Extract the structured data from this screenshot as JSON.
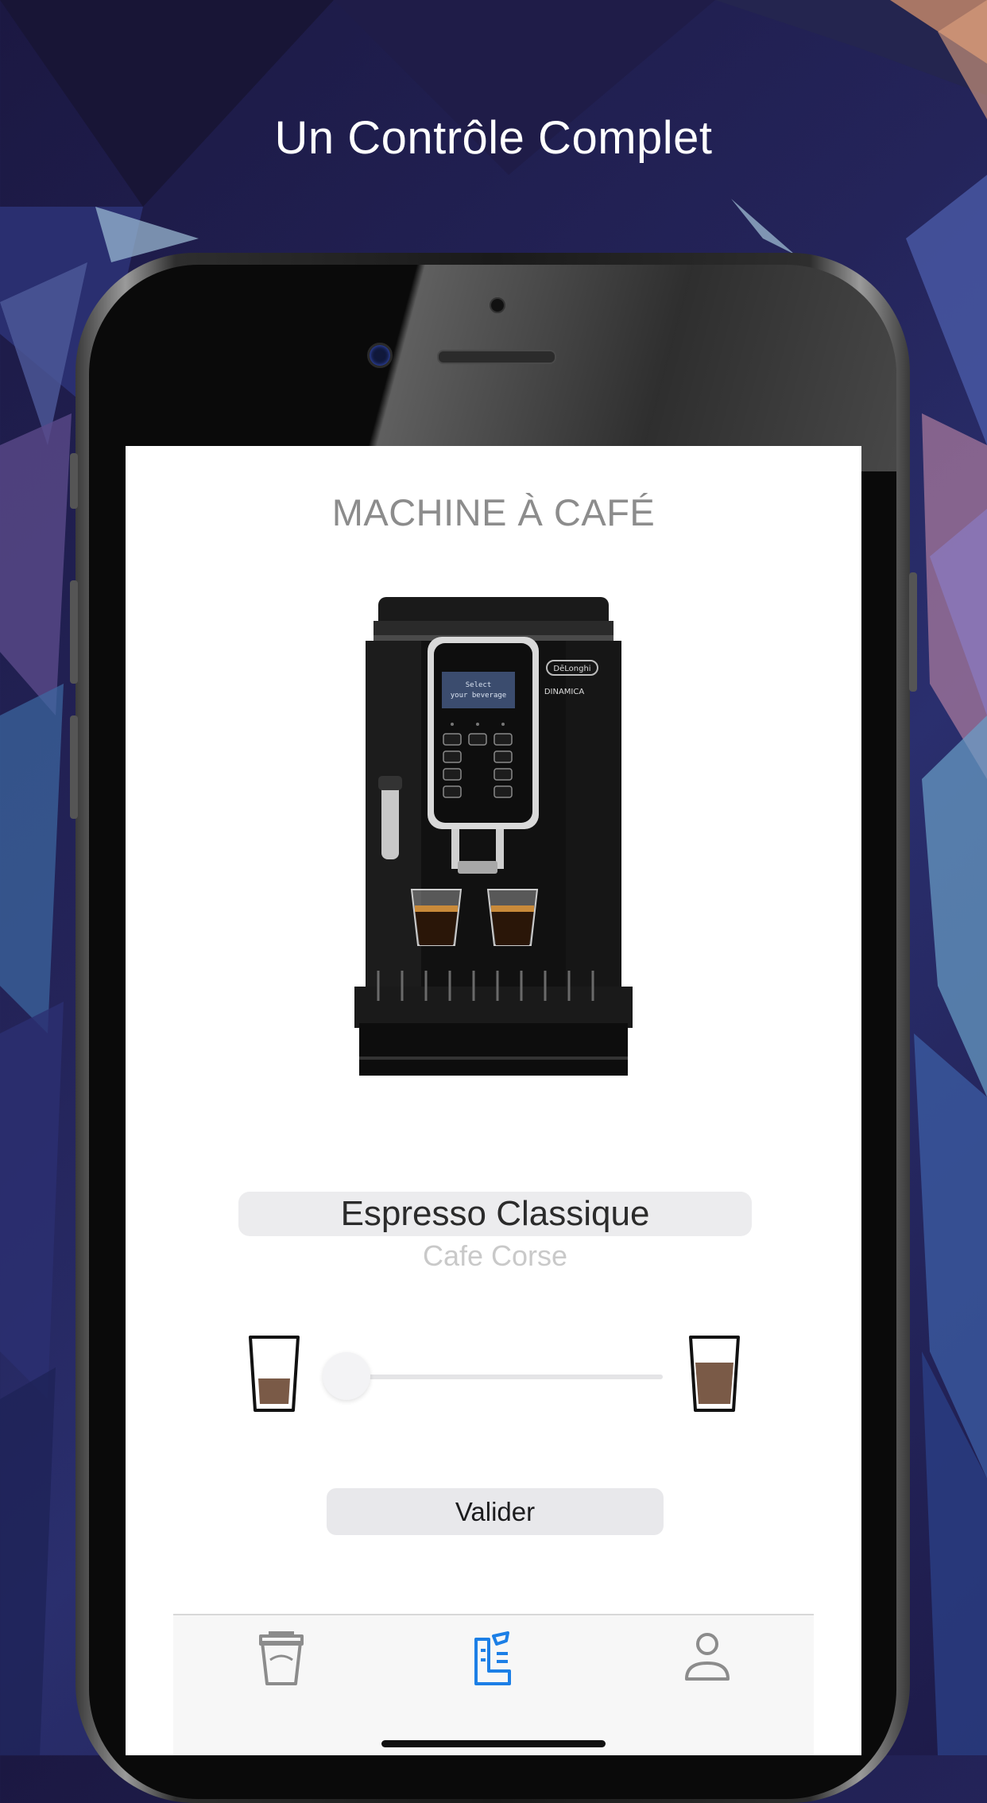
{
  "promo": {
    "headline": "Un Contrôle Complet"
  },
  "app": {
    "title": "MACHINE À CAFÉ",
    "machine_display": {
      "line1": "Select",
      "line2": "your beverage",
      "brand": "DēLonghi",
      "model": "DINAMICA"
    },
    "beverage_picker": {
      "selected": "Espresso Classique",
      "next": "Cafe Corse"
    },
    "size_slider": {
      "value": 0.0,
      "min_icon": "small-cup-icon",
      "max_icon": "large-cup-icon"
    },
    "validate_label": "Valider",
    "tabbar": {
      "tabs": [
        {
          "icon": "coffee-cup-icon",
          "active": false
        },
        {
          "icon": "machine-control-icon",
          "active": true
        },
        {
          "icon": "profile-icon",
          "active": false
        }
      ]
    },
    "colors": {
      "accent": "#1c7fe6",
      "tab_inactive": "#8c8c8c"
    }
  }
}
